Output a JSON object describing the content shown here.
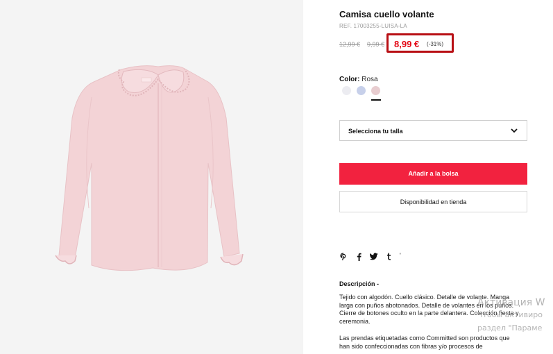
{
  "product": {
    "title": "Camisa cuello volante",
    "ref": "REF. 17003255-LUISA-LA",
    "prices": {
      "original": "12,99 €",
      "previous": "9,99 €",
      "current": "8,99 €",
      "discount": "(-31%)"
    },
    "color": {
      "label": "Color:",
      "value": "Rosa",
      "swatches": [
        {
          "name": "white",
          "hex": "#ececf1"
        },
        {
          "name": "blue",
          "hex": "#c7d0ea"
        },
        {
          "name": "pink",
          "hex": "#e8cdd0",
          "selected": true
        }
      ]
    }
  },
  "size_select": {
    "label": "Selecciona tu talla"
  },
  "buttons": {
    "add_to_bag": "Añadir a la bolsa",
    "store_availability": "Disponibilidad en tienda"
  },
  "share": {
    "icons": [
      "pinterest-icon",
      "facebook-icon",
      "twitter-icon",
      "tumblr-icon",
      "more-icon"
    ],
    "more_text": "'"
  },
  "description": {
    "title": "Descripción -",
    "paragraph1": "Tejido con algodón. Cuello clásico. Detalle de volante. Manga larga con puños abotonados. Detalle de volantes en los puños. Cierre de botones oculto en la parte delantera. Colección fiesta y ceremonia.",
    "paragraph2": "Las prendas etiquetadas como Committed son productos que han sido confeccionadas con fibras y/o procesos de"
  },
  "watermark": {
    "line1": "Активация W",
    "line2": "Чтобы активиро",
    "line3": "раздел \"Парамe"
  },
  "colors": {
    "accent_red": "#f2223f",
    "price_red": "#e30613",
    "highlight_border": "#b80f14",
    "shirt": "#f3d3d6"
  }
}
